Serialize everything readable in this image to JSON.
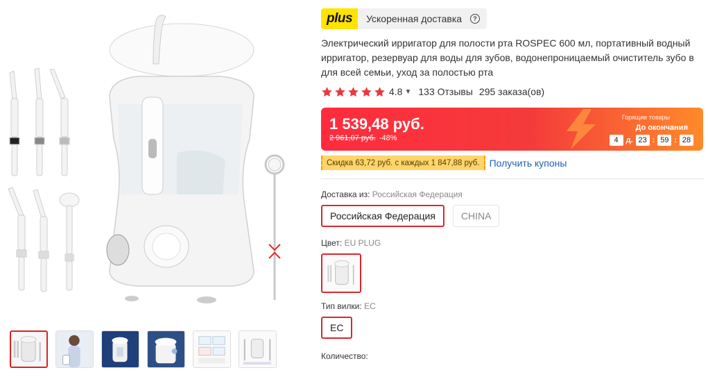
{
  "gallery": {
    "thumbnails": [
      {
        "name": "thumb-1",
        "active": true
      },
      {
        "name": "thumb-2",
        "active": false
      },
      {
        "name": "thumb-3",
        "active": false
      },
      {
        "name": "thumb-4",
        "active": false
      },
      {
        "name": "thumb-5",
        "active": false
      },
      {
        "name": "thumb-6",
        "active": false
      }
    ]
  },
  "delivery_badge": {
    "logo": "plus",
    "text": "Ускоренная доставка",
    "icon": "question-circle-icon"
  },
  "product": {
    "title": "Электрический ирригатор для полости рта ROSPEC 600 мл, портативный водный ирригатор, резервуар для воды для зубов, водонепроницаемый очиститель зубо в для всей семьи, уход за полостью рта",
    "rating": "4.8",
    "stars": 5,
    "reviews": "133 Отзывы",
    "orders": "295 заказа(ов)"
  },
  "price": {
    "current": "1 539,48 руб.",
    "old": "2 961,07 руб.",
    "discount": "-48%",
    "hot_label": "Горящие товары",
    "countdown_label": "До окончания",
    "timer": {
      "days": "4",
      "days_suffix": "д.",
      "hours": "23",
      "minutes": "59",
      "seconds": "28"
    }
  },
  "coupon": {
    "tag": "Скидка 63,72 руб. с каждых 1 847,88 руб.",
    "link": "Получить купоны"
  },
  "shipping": {
    "label": "Доставка из:",
    "selected_value": "Российская Федерация",
    "options": [
      "Российская Федерация",
      "CHINA"
    ]
  },
  "color": {
    "label": "Цвет:",
    "selected_value": "EU PLUG"
  },
  "plug": {
    "label": "Тип вилки:",
    "selected_value": "EC",
    "options": [
      "EC"
    ]
  },
  "quantity": {
    "label": "Количество:"
  },
  "colors": {
    "accent_red": "#d9272e",
    "price_gradient_start": "#ff2b3d",
    "price_gradient_end": "#ff8a2a",
    "plus_yellow": "#ffe400",
    "link_blue": "#1e5fb4",
    "star": "#e8393f"
  }
}
